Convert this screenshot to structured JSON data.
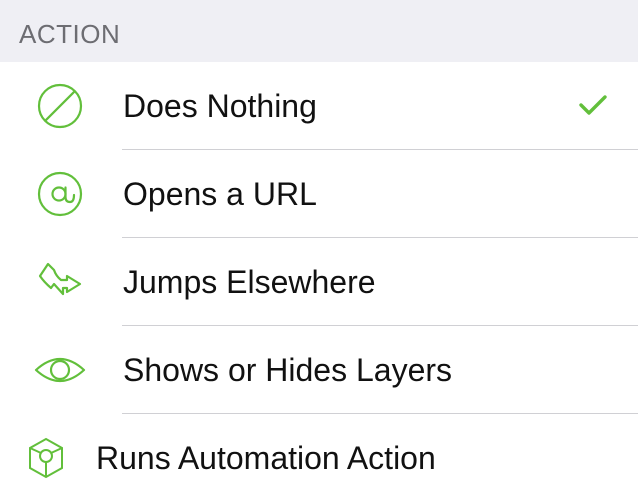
{
  "section": {
    "title": "ACTION"
  },
  "colors": {
    "accent": "#62bf3b",
    "header_bg": "#efeff4",
    "header_text": "#6d6d72",
    "separator": "#d0d0d4"
  },
  "options": [
    {
      "label": "Does Nothing",
      "icon": "prohibited-icon",
      "selected": true
    },
    {
      "label": "Opens a URL",
      "icon": "at-sign-icon",
      "selected": false
    },
    {
      "label": "Jumps Elsewhere",
      "icon": "jump-arrow-icon",
      "selected": false
    },
    {
      "label": "Shows or Hides Layers",
      "icon": "eye-icon",
      "selected": false
    },
    {
      "label": "Runs Automation Action",
      "icon": "automation-cube-icon",
      "selected": false
    }
  ]
}
